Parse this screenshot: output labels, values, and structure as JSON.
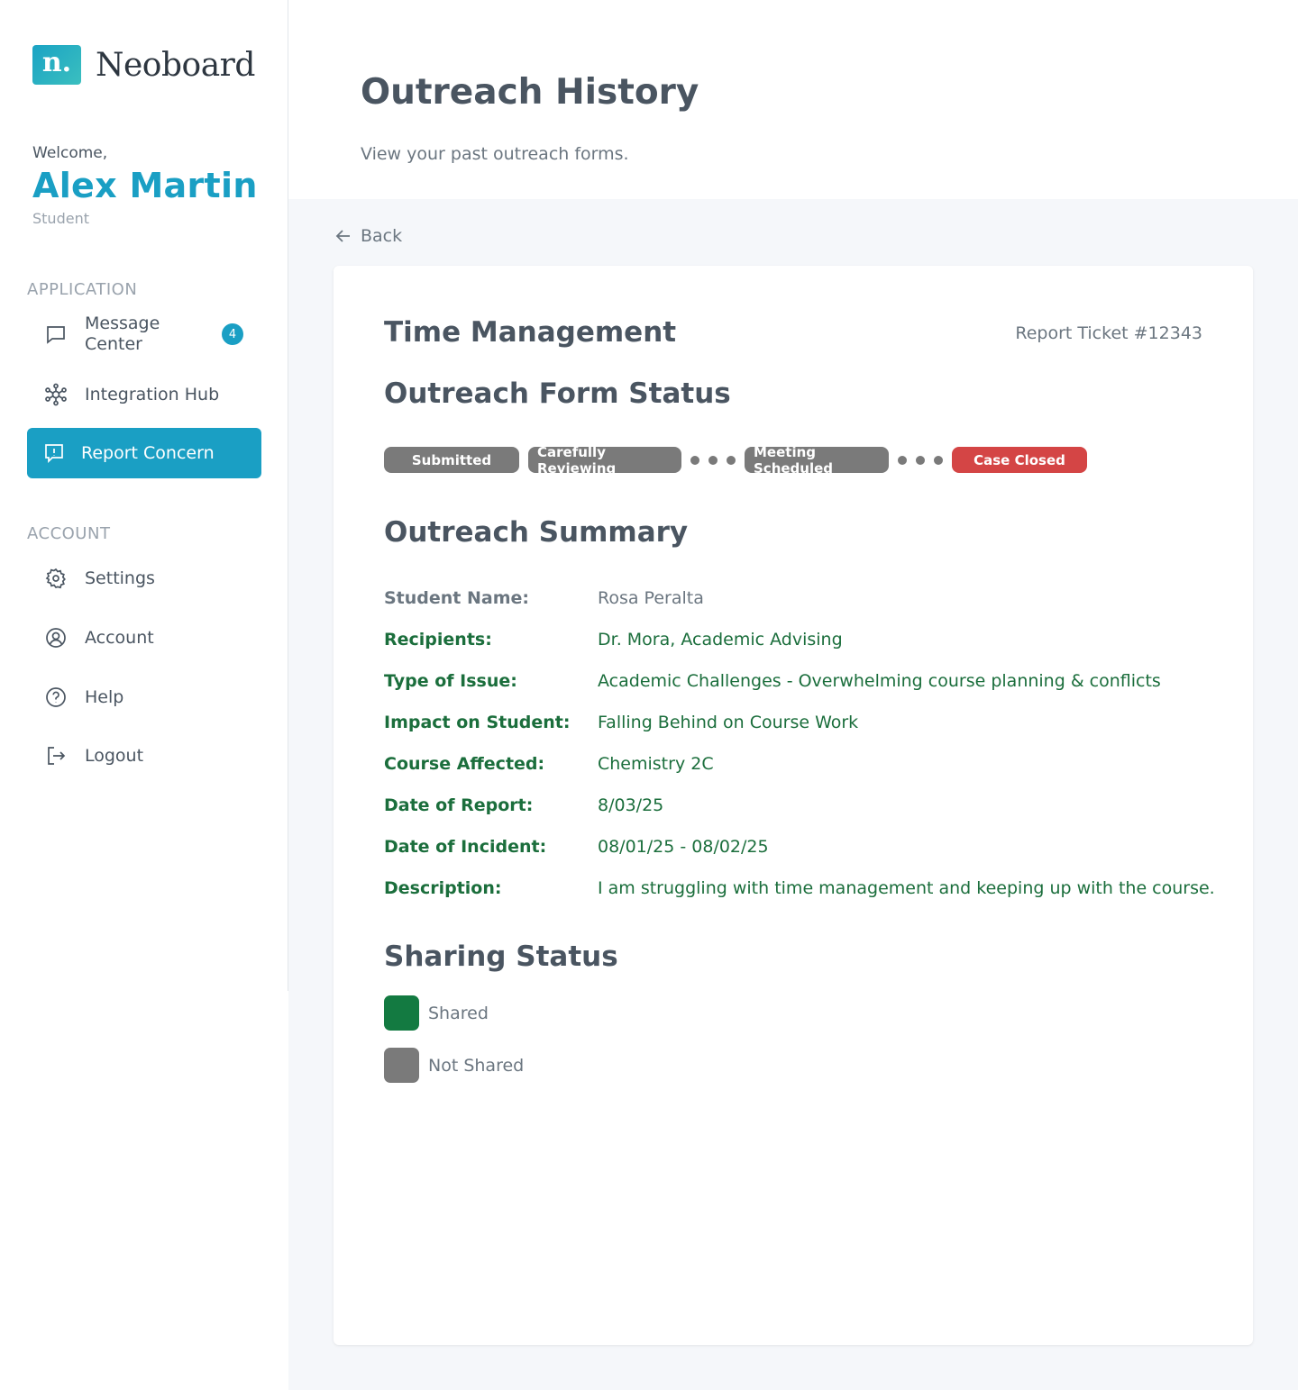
{
  "brand": {
    "mark": "n.",
    "name": "Neoboard"
  },
  "user": {
    "welcome": "Welcome,",
    "name": "Alex Martin",
    "role": "Student"
  },
  "sidebar": {
    "application_label": "APPLICATION",
    "account_label": "ACCOUNT",
    "items": [
      {
        "label": "Message\nCenter",
        "badge": "4",
        "icon": "message-icon"
      },
      {
        "label": "Integration Hub",
        "icon": "integration-hub-icon"
      },
      {
        "label": "Report Concern",
        "icon": "report-icon",
        "active": true
      },
      {
        "label": "Settings",
        "icon": "gear-icon"
      },
      {
        "label": "Account",
        "icon": "user-circle-icon"
      },
      {
        "label": "Help",
        "icon": "help-icon"
      },
      {
        "label": "Logout",
        "icon": "logout-icon"
      }
    ]
  },
  "header": {
    "title": "Outreach History",
    "subtitle": "View your past outreach forms."
  },
  "back_label": "Back",
  "card": {
    "title": "Time Management",
    "ticket": "Report Ticket #12343",
    "status_heading": "Outreach Form Status",
    "statuses": [
      "Submitted",
      "Carefully Reviewing",
      "Meeting Scheduled",
      "Case Closed"
    ],
    "summary_heading": "Outreach Summary",
    "summary": [
      {
        "label": "Student Name:",
        "value": "Rosa Peralta"
      },
      {
        "label": "Recipients:",
        "value": "Dr. Mora, Academic Advising"
      },
      {
        "label": "Type of Issue:",
        "value": "Academic Challenges - Overwhelming course planning & conflicts"
      },
      {
        "label": "Impact on Student:",
        "value": "Falling Behind on Course Work"
      },
      {
        "label": "Course Affected:",
        "value": "Chemistry 2C"
      },
      {
        "label": "Date of Report:",
        "value": "8/03/25"
      },
      {
        "label": "Date of Incident:",
        "value": "08/01/25 - 08/02/25"
      },
      {
        "label": "Description:",
        "value": "I am struggling with time management and keeping up with the course."
      }
    ],
    "sharing_heading": "Sharing Status",
    "legend": [
      {
        "label": "Shared",
        "color": "#137a41"
      },
      {
        "label": "Not Shared",
        "color": "#7a7a7a"
      }
    ]
  },
  "colors": {
    "accent": "#1a9fc4",
    "shared_green": "#137a41",
    "closed_red": "#d44545",
    "pill_gray": "#7a7a7a"
  }
}
